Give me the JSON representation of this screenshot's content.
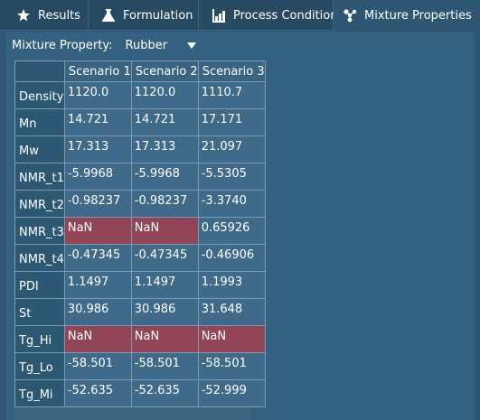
{
  "tabs": [
    {
      "label": "Results",
      "icon": "star-icon"
    },
    {
      "label": "Formulation",
      "icon": "flask-icon"
    },
    {
      "label": "Process Conditions",
      "icon": "bar-chart-icon"
    },
    {
      "label": "Mixture Properties",
      "icon": "molecule-icon"
    }
  ],
  "active_tab": "Mixture Properties",
  "mixture_property": {
    "label": "Mixture Property:",
    "value": "Rubber"
  },
  "table": {
    "columns": [
      "Scenario 1",
      "Scenario 2",
      "Scenario 3"
    ],
    "rows": [
      {
        "name": "Density",
        "values": [
          "1120.0",
          "1120.0",
          "1110.7"
        ]
      },
      {
        "name": "Mn",
        "values": [
          "14.721",
          "14.721",
          "17.171"
        ]
      },
      {
        "name": "Mw",
        "values": [
          "17.313",
          "17.313",
          "21.097"
        ]
      },
      {
        "name": "NMR_t1",
        "values": [
          "-5.9968",
          "-5.9968",
          "-5.5305"
        ]
      },
      {
        "name": "NMR_t2",
        "values": [
          "-0.98237",
          "-0.98237",
          "-3.3740"
        ]
      },
      {
        "name": "NMR_t3",
        "values": [
          "NaN",
          "NaN",
          "0.65926"
        ]
      },
      {
        "name": "NMR_t4",
        "values": [
          "-0.47345",
          "-0.47345",
          "-0.46906"
        ]
      },
      {
        "name": "PDI",
        "values": [
          "1.1497",
          "1.1497",
          "1.1993"
        ]
      },
      {
        "name": "St",
        "values": [
          "30.986",
          "30.986",
          "31.648"
        ]
      },
      {
        "name": "Tg_Hi",
        "values": [
          "NaN",
          "NaN",
          "NaN"
        ]
      },
      {
        "name": "Tg_Lo",
        "values": [
          "-58.501",
          "-58.501",
          "-58.501"
        ]
      },
      {
        "name": "Tg_Mi",
        "values": [
          "-52.635",
          "-52.635",
          "-52.999"
        ]
      }
    ]
  },
  "colors": {
    "nan_highlight": "#934558",
    "background": "#2f5673"
  }
}
